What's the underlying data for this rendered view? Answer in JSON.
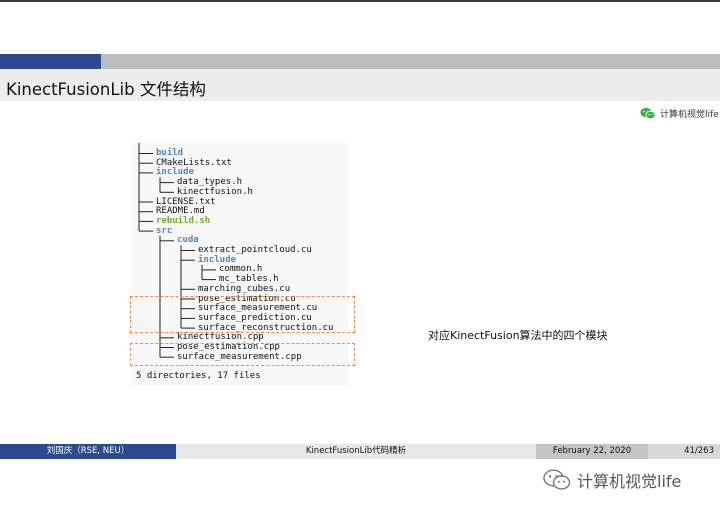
{
  "header": {
    "title": "KinectFusionLib 文件结构"
  },
  "watermark_small": {
    "icon": "wechat-icon",
    "text": "计算机视觉life"
  },
  "tree": [
    {
      "prefix": "├── ",
      "name": "build",
      "kind": "dir"
    },
    {
      "prefix": "├── ",
      "name": "CMakeLists.txt",
      "kind": "file"
    },
    {
      "prefix": "├── ",
      "name": "include",
      "kind": "dir"
    },
    {
      "prefix": "│   ├── ",
      "name": "data_types.h",
      "kind": "file"
    },
    {
      "prefix": "│   └── ",
      "name": "kinectfusion.h",
      "kind": "file"
    },
    {
      "prefix": "├── ",
      "name": "LICENSE.txt",
      "kind": "file"
    },
    {
      "prefix": "├── ",
      "name": "README.md",
      "kind": "file"
    },
    {
      "prefix": "├── ",
      "name": "rebuild.sh",
      "kind": "exec"
    },
    {
      "prefix": "└── ",
      "name": "src",
      "kind": "dir"
    },
    {
      "prefix": "    ├── ",
      "name": "cuda",
      "kind": "dir"
    },
    {
      "prefix": "    │   ├── ",
      "name": "extract_pointcloud.cu",
      "kind": "file"
    },
    {
      "prefix": "    │   ├── ",
      "name": "include",
      "kind": "dir"
    },
    {
      "prefix": "    │   │   ├── ",
      "name": "common.h",
      "kind": "file"
    },
    {
      "prefix": "    │   │   └── ",
      "name": "mc_tables.h",
      "kind": "file"
    },
    {
      "prefix": "    │   ├── ",
      "name": "marching_cubes.cu",
      "kind": "file"
    },
    {
      "prefix": "    │   ├── ",
      "name": "pose_estimation.cu",
      "kind": "file"
    },
    {
      "prefix": "    │   ├── ",
      "name": "surface_measurement.cu",
      "kind": "file"
    },
    {
      "prefix": "    │   ├── ",
      "name": "surface_prediction.cu",
      "kind": "file"
    },
    {
      "prefix": "    │   └── ",
      "name": "surface_reconstruction.cu",
      "kind": "file"
    },
    {
      "prefix": "    ├── ",
      "name": "kinectfusion.cpp",
      "kind": "file"
    },
    {
      "prefix": "    ├── ",
      "name": "pose_estimation.cpp",
      "kind": "file"
    },
    {
      "prefix": "    └── ",
      "name": "surface_measurement.cpp",
      "kind": "file"
    }
  ],
  "tree_summary": "5 directories, 17 files",
  "annotation": "对应KinectFusion算法中的四个模块",
  "footer": {
    "author": "刘国庆（RSE, NEU）",
    "title": "KinectFusionLib代码精析",
    "date": "February 22, 2020",
    "page": "41/263"
  },
  "watermark_big": {
    "icon": "wechat-icon",
    "text": "计算机视觉life"
  },
  "colors": {
    "accent_blue": "#2e4a8f",
    "dir_blue": "#4a86c8",
    "exec_green": "#72a832",
    "dash_orange": "#f08a4b"
  }
}
